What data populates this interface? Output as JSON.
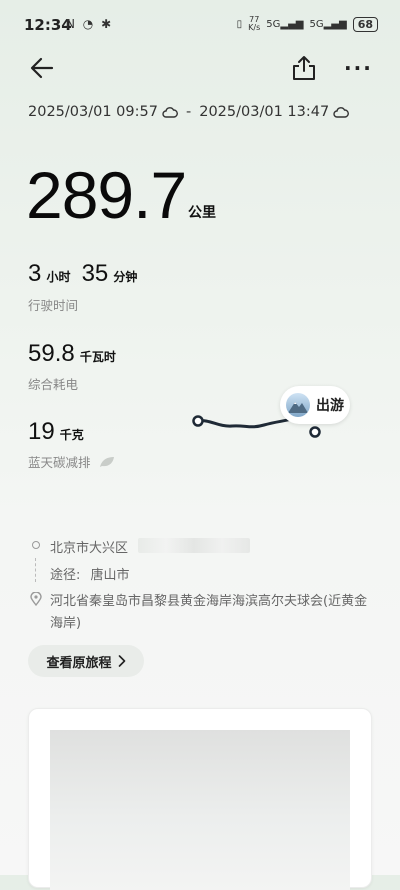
{
  "status_bar": {
    "time": "12:34",
    "left_icons": "N ◔ ✱",
    "speed_value": "77",
    "speed_unit": "K/s",
    "signal1": "5G",
    "signal2": "5G",
    "battery": "68"
  },
  "trip": {
    "range_start": "2025/03/01 09:57",
    "range_separator": "-",
    "range_end": "2025/03/01 13:47",
    "distance": "289.7",
    "distance_unit": "公里",
    "duration_hours": "3",
    "hours_unit": "小时",
    "duration_minutes": "35",
    "minutes_unit": "分钟",
    "duration_label": "行驶时间",
    "energy": "59.8",
    "energy_unit": "千瓦时",
    "energy_label": "综合耗电",
    "carbon": "19",
    "carbon_unit": "千克",
    "carbon_label": "蓝天碳减排"
  },
  "map": {
    "tag_label": "出游",
    "route_color": "#1f2a36"
  },
  "route": {
    "start_text": "北京市大兴区",
    "via_label": "途径:",
    "via_value": "唐山市",
    "end_line1": "河北省秦皇岛市昌黎县黄金海岸海滨高尔夫球会(近黄金",
    "end_line2": "海岸)"
  },
  "actions": {
    "view_original": "查看原旅程"
  },
  "icons": {
    "back": "back-arrow-icon",
    "share": "share-icon",
    "more": "more-icon",
    "weather": "cloud-icon",
    "leaf": "leaf-icon",
    "chevron": "chevron-right-icon"
  }
}
